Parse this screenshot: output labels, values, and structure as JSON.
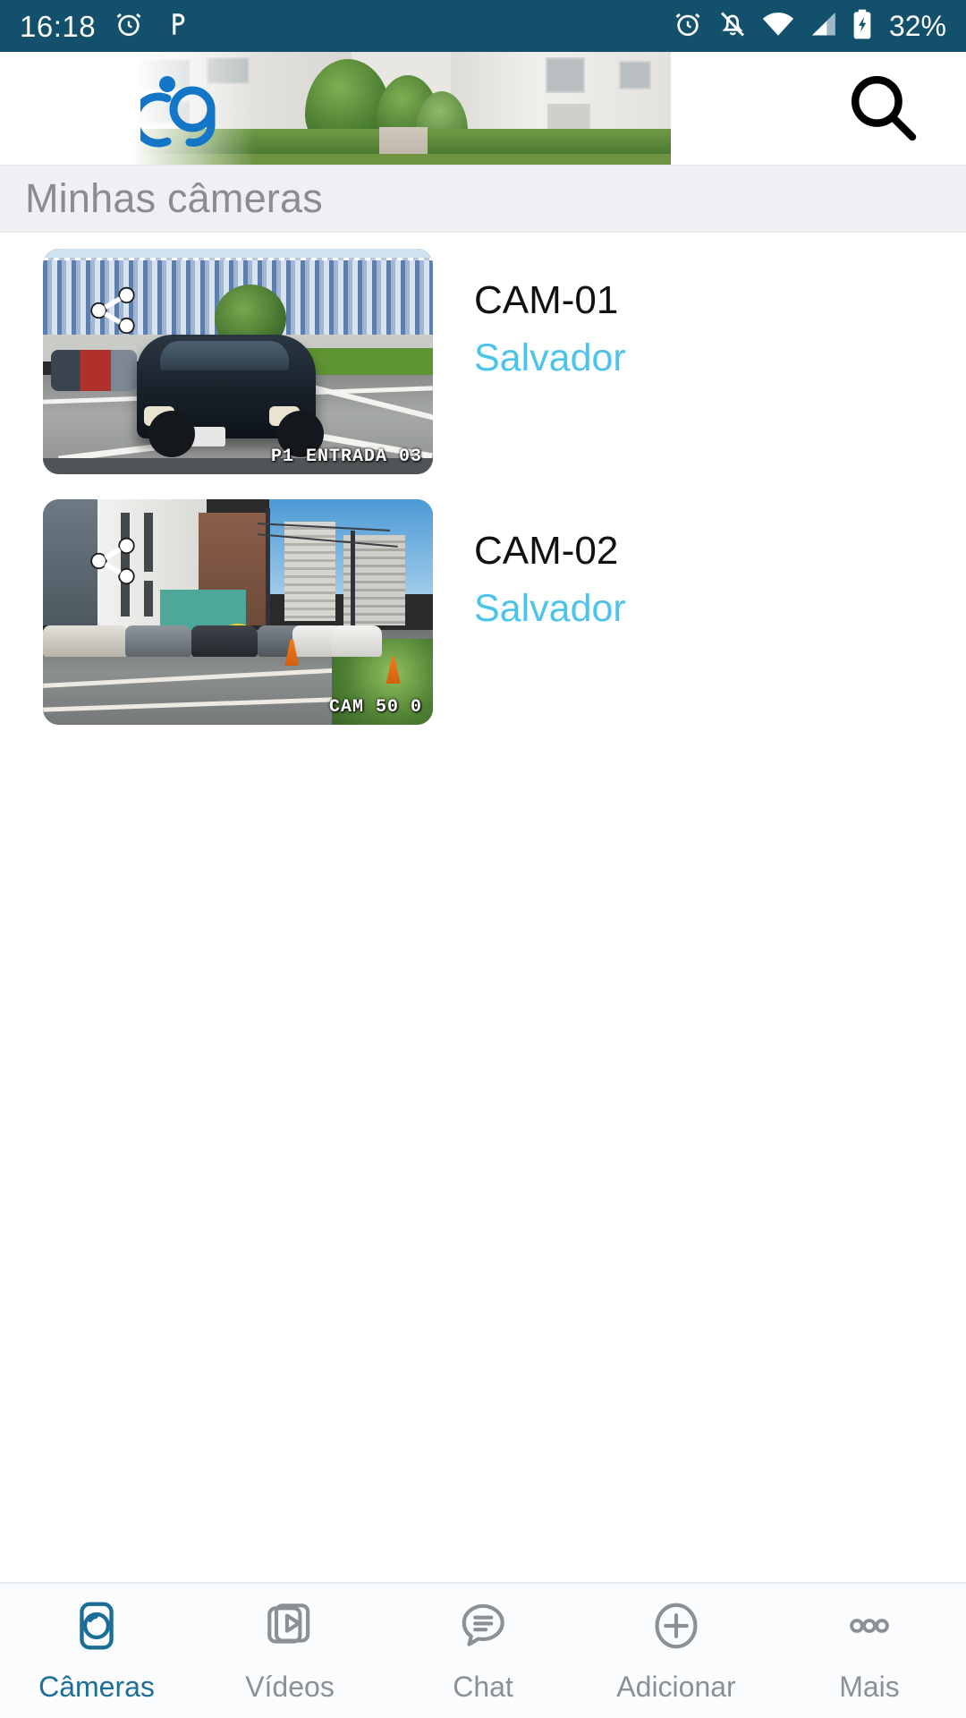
{
  "statusbar": {
    "time": "16:18",
    "battery": "32%",
    "left_icons": [
      "alarm-icon",
      "pocket-casts-icon"
    ],
    "right_icons": [
      "alarm-icon",
      "notifications-off-icon",
      "wifi-icon",
      "cellular-signal-icon",
      "battery-charging-icon"
    ],
    "background": "#12506b",
    "foreground": "#ffffff"
  },
  "appbar": {
    "logo_name": "i9-logo",
    "logo_text": "i9",
    "search_label": "search-icon"
  },
  "section": {
    "title": "Minhas câmeras"
  },
  "cameras": [
    {
      "name": "CAM-01",
      "location": "Salvador",
      "overlay": "P1  ENTRADA 03",
      "share_label": "share-icon"
    },
    {
      "name": "CAM-02",
      "location": "Salvador",
      "overlay": "CAM 50 0",
      "share_label": "share-icon"
    }
  ],
  "bottom_nav": {
    "active_index": 0,
    "items": [
      {
        "label": "Câmeras",
        "icon": "camera-icon"
      },
      {
        "label": "Vídeos",
        "icon": "video-library-icon"
      },
      {
        "label": "Chat",
        "icon": "chat-bubble-icon"
      },
      {
        "label": "Adicionar",
        "icon": "plus-circle-icon"
      },
      {
        "label": "Mais",
        "icon": "more-horizontal-icon"
      }
    ]
  },
  "colors": {
    "status_bar": "#12506b",
    "accent": "#1d6e96",
    "location_text": "#4cc3ea",
    "section_bg": "#f0f0f4",
    "section_text": "#8b8b92",
    "nav_inactive": "#8a9096"
  }
}
